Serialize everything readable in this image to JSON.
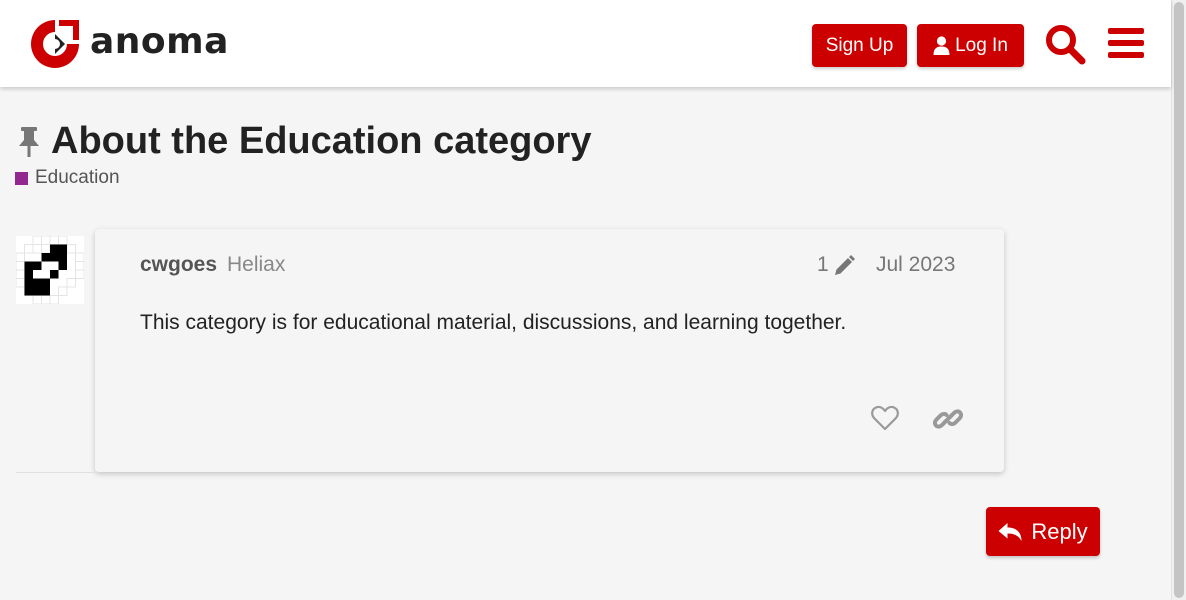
{
  "header": {
    "brand": "anoma",
    "signup_label": "Sign Up",
    "login_label": "Log In",
    "icons": [
      "anoma-logo-icon",
      "user-icon",
      "search-icon",
      "hamburger-menu-icon"
    ]
  },
  "topic": {
    "title": "About the Education category",
    "category": {
      "name": "Education",
      "color": "#92278f"
    }
  },
  "post": {
    "username": "cwgoes",
    "user_title": "Heliax",
    "edit_count": "1",
    "date": "Jul 2023",
    "body": "This category is for educational material, discussions, and learning together.",
    "icons": [
      "avatar",
      "pencil-icon",
      "heart-icon",
      "link-icon"
    ]
  },
  "footer": {
    "reply_label": "Reply",
    "icons": [
      "reply-arrow-icon"
    ]
  },
  "colors": {
    "accent": "#cc0000",
    "background": "#f5f5f5",
    "category": "#92278f"
  }
}
